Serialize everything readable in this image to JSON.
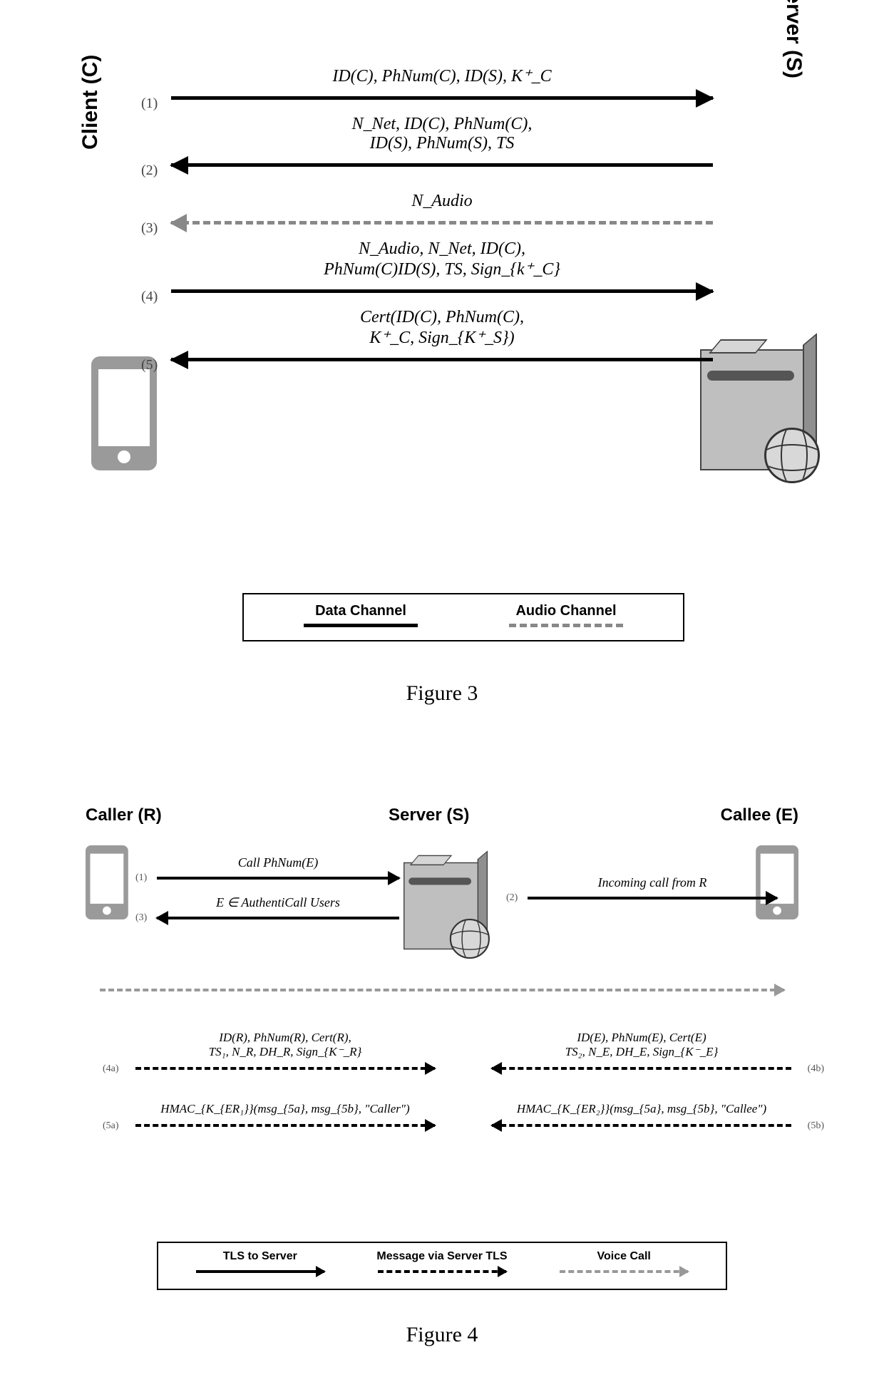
{
  "fig3": {
    "left_label": "Client (C)",
    "right_label": "Server (S)",
    "rows": [
      {
        "num": "(1)",
        "dir": "right",
        "style": "solid",
        "text_a": "ID(C), PhNum(C), ID(S), K⁺_C",
        "text_b": ""
      },
      {
        "num": "(2)",
        "dir": "left",
        "style": "solid",
        "text_a": "N_Net, ID(C), PhNum(C),",
        "text_b": "ID(S), PhNum(S), TS"
      },
      {
        "num": "(3)",
        "dir": "left",
        "style": "dashed",
        "text_a": "N_Audio",
        "text_b": ""
      },
      {
        "num": "(4)",
        "dir": "right",
        "style": "solid",
        "text_a": "N_Audio, N_Net, ID(C),",
        "text_b": "PhNum(C)ID(S), TS, Sign_{k⁺_C}"
      },
      {
        "num": "(5)",
        "dir": "left",
        "style": "solid",
        "text_a": "Cert(ID(C), PhNum(C),",
        "text_b": "K⁺_C, Sign_{K⁺_S})"
      }
    ],
    "legend": {
      "data": "Data Channel",
      "audio": "Audio Channel"
    },
    "caption": "Figure 3"
  },
  "fig4": {
    "roles": {
      "caller": "Caller (R)",
      "server": "Server (S)",
      "callee": "Callee (E)"
    },
    "top_rows": {
      "r1_left_label": "Call PhNum(E)",
      "r1_left_num": "(1)",
      "r2_right_label": "Incoming call from R",
      "r2_right_num": "(2)",
      "r3_left_label": "E ∈ AuthentiCall Users",
      "r3_left_num": "(3)"
    },
    "mid_rows": {
      "r4a_label_a": "ID(R), PhNum(R), Cert(R),",
      "r4a_label_b": "TS₁, N_R, DH_R, Sign_{K⁻_R}",
      "r4a_num": "(4a)",
      "r4b_label_a": "ID(E), PhNum(E), Cert(E)",
      "r4b_label_b": "TS₂, N_E, DH_E, Sign_{K⁻_E}",
      "r4b_num": "(4b)",
      "r5a_label": "HMAC_{K_{ER₁}}(msg_{5a}, msg_{5b}, \"Caller\")",
      "r5a_num": "(5a)",
      "r5b_label": "HMAC_{K_{ER₂}}(msg_{5a}, msg_{5b}, \"Callee\")",
      "r5b_num": "(5b)"
    },
    "legend": {
      "tls": "TLS to Server",
      "msg": "Message via Server TLS",
      "voice": "Voice Call"
    },
    "caption": "Figure 4"
  }
}
